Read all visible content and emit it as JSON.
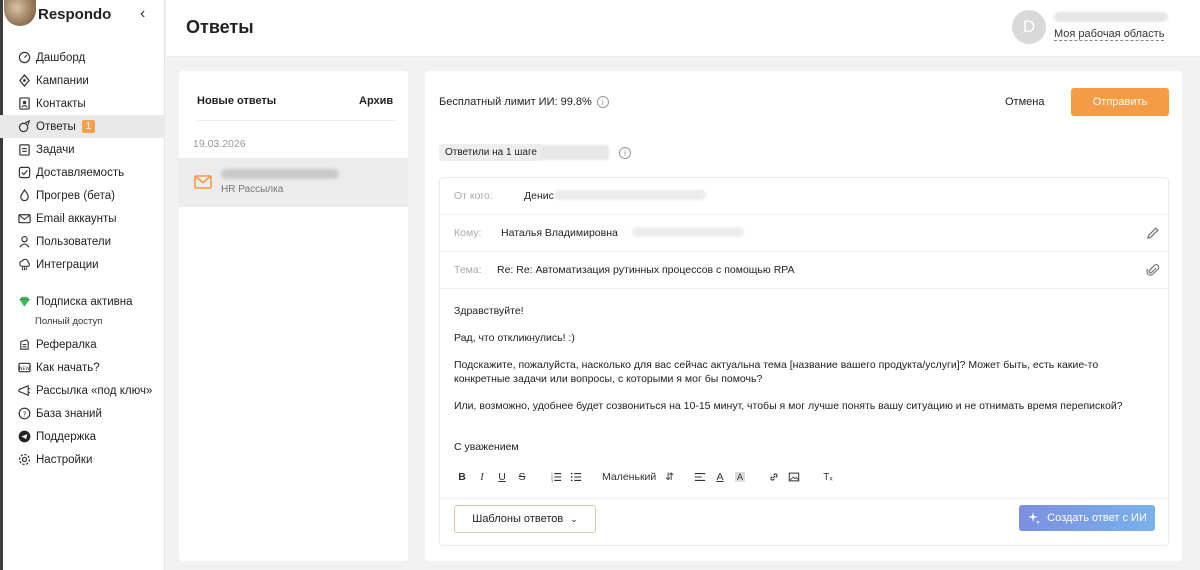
{
  "app": {
    "name": "Respondo"
  },
  "sidebar": {
    "items": [
      {
        "label": "Дашборд",
        "icon": "dashboard-icon"
      },
      {
        "label": "Кампании",
        "icon": "campaigns-icon"
      },
      {
        "label": "Контакты",
        "icon": "contacts-icon"
      },
      {
        "label": "Ответы",
        "icon": "replies-icon",
        "badge": "1",
        "active": true
      },
      {
        "label": "Задачи",
        "icon": "tasks-icon"
      },
      {
        "label": "Доставляемость",
        "icon": "deliverability-icon"
      },
      {
        "label": "Прогрев (бета)",
        "icon": "warmup-icon"
      },
      {
        "label": "Email аккаунты",
        "icon": "mail-icon"
      },
      {
        "label": "Пользователи",
        "icon": "users-icon"
      },
      {
        "label": "Интеграции",
        "icon": "integrations-icon"
      }
    ],
    "subscription": {
      "label": "Подписка активна",
      "sub": "Полный доступ",
      "icon": "diamond-icon"
    },
    "bottom_items": [
      {
        "label": "Рефералка",
        "icon": "referral-icon"
      },
      {
        "label": "Как начать?",
        "icon": "start-icon"
      },
      {
        "label": "Рассылка «под ключ»",
        "icon": "turnkey-icon"
      },
      {
        "label": "База знаний",
        "icon": "knowledge-icon"
      },
      {
        "label": "Поддержка",
        "icon": "telegram-icon"
      },
      {
        "label": "Настройки",
        "icon": "settings-icon"
      }
    ]
  },
  "header": {
    "title": "Ответы",
    "avatar_letter": "D",
    "workspace": "Моя рабочая область"
  },
  "list": {
    "tabs": [
      "Новые ответы",
      "Архив"
    ],
    "date": "19.03.2026",
    "conversation": {
      "subtitle": "HR Рассылка"
    }
  },
  "compose": {
    "ai_limit": "Бесплатный лимит ИИ: 99.8%",
    "cancel": "Отмена",
    "send": "Отправить",
    "step_chip": "Ответили на 1 шаге",
    "from_label": "От кого:",
    "from_value": "Денис",
    "to_label": "Кому:",
    "to_value": "Наталья Владимировна",
    "subject_label": "Тема:",
    "subject_value": "Re: Re: Автоматизация рутинных процессов с помощью RPA",
    "body": [
      "Здравствуйте!",
      "Рад, что откликнулись! :)",
      "Подскажите, пожалуйста, насколько для вас сейчас актуальна тема [название вашего продукта/услуги]? Может быть, есть какие-то конкретные задачи или вопросы, с которыми я мог бы помочь?",
      "Или, возможно, удобнее будет созвониться на 10-15 минут, чтобы я мог лучше понять вашу ситуацию и не отнимать время перепиской?",
      "С уважением"
    ],
    "font_size": "Маленький",
    "templates_button": "Шаблоны ответов",
    "ai_button": "Создать ответ с ИИ"
  },
  "colors": {
    "accent": "#f39b45",
    "ai_button": "#7d9fe6"
  }
}
